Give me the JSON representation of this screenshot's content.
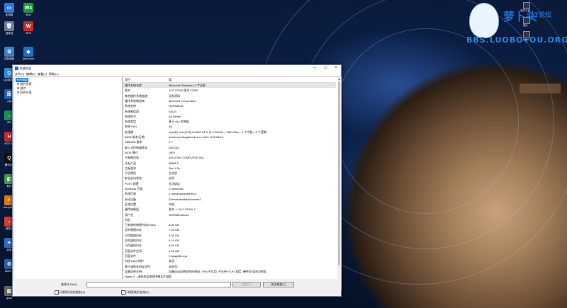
{
  "wallpaper": {
    "accent": "#0b1f45",
    "planet": "#a27d58"
  },
  "logo": {
    "title": "萝卜头",
    "subtitle": "IT论坛",
    "url": "BBS.LUOBOTOU.ORG"
  },
  "corner_items": [
    {
      "label": "我的文档"
    },
    {
      "label": "图片"
    },
    {
      "label": "good"
    }
  ],
  "thumb_label": "",
  "desktop_icons": [
    {
      "label": "此电脑",
      "color": "#2a7ad8",
      "glyph": "▭"
    },
    {
      "label": "Wox",
      "color": "#1c9a3e",
      "glyph": "Wx"
    },
    {
      "label": "回收站",
      "color": "#6c7c94",
      "glyph": "🗑"
    },
    {
      "label": "WPS",
      "color": "#d3262b",
      "glyph": "W"
    },
    {
      "label": "控制面板",
      "color": "#3b82c4",
      "glyph": "⚙"
    },
    {
      "label": "QuickLook",
      "color": "#1d6fd1",
      "glyph": "◆"
    },
    {
      "label": "QQ浏览器",
      "color": "#2f8de4",
      "glyph": "Q"
    },
    {
      "label": "火绒",
      "color": "#1e5fb8",
      "glyph": "盾"
    },
    {
      "label": "IDM",
      "color": "#1d8f4e",
      "glyph": "↓"
    },
    {
      "label": "HDTune",
      "color": "#c7282e",
      "glyph": "H"
    },
    {
      "label": "腾讯QQ",
      "color": "#111111",
      "glyph": "Q"
    },
    {
      "label": "软件",
      "color": "#3d9e3b",
      "glyph": "◧"
    },
    {
      "label": "Everything",
      "color": "#e07d12",
      "glyph": "⌕"
    },
    {
      "label": "网易云",
      "color": "#d93a2f",
      "glyph": "♪"
    },
    {
      "label": "应用",
      "color": "#2c6cc8",
      "glyph": "✦"
    },
    {
      "label": "Dism++",
      "color": "#2a5fae",
      "glyph": "⚙"
    },
    {
      "label": "good",
      "color": "#666666",
      "glyph": "▥"
    }
  ],
  "window": {
    "title": "系统信息",
    "menu": [
      "文件(F)",
      "编辑(E)",
      "查看(V)",
      "帮助(H)"
    ],
    "tree": [
      "系统摘要",
      "硬件资源",
      "组件",
      "软件环境"
    ],
    "columns": [
      "项目",
      "值"
    ],
    "rows": [
      [
        "操作系统名称",
        "Microsoft Windows 11 专业版"
      ],
      [
        "版本",
        "10.0.22000 版本 22000"
      ],
      [
        "其他操作系统描述",
        "没有资料"
      ],
      [
        "操作系统制造商",
        "Microsoft Corporation"
      ],
      [
        "系统名称",
        "NXNK8644"
      ],
      [
        "系统制造商",
        "ASUS"
      ],
      [
        "系统型号",
        "All Series"
      ],
      [
        "系统类型",
        "基于 x64 的电脑"
      ],
      [
        "系统 SKU",
        "All"
      ],
      [
        "处理器",
        "Intel(R) Core(TM) i5-4590 CPU @ 3.30GHz，3301 Mhz，4 个内核，4 个逻辑..."
      ],
      [
        "BIOS 版本/日期",
        "American Megatrends Inc. 0401, 2014/5/19"
      ],
      [
        "SMBIOS 版本",
        "2.7"
      ],
      [
        "嵌入式控制器版本",
        "255.255"
      ],
      [
        "BIOS 模式",
        "UEFI"
      ],
      [
        "主板制造商",
        "ASUSTeK COMPUTER INC."
      ],
      [
        "主板产品",
        "B85M-F"
      ],
      [
        "主板版本",
        "Rev X.0x"
      ],
      [
        "平台角色",
        "台式机"
      ],
      [
        "安全启动状态",
        "启用"
      ],
      [
        "PCR7 配置",
        "无法绑定"
      ],
      [
        "Windows 目录",
        "C:\\windows"
      ],
      [
        "系统目录",
        "C:\\windows\\system32"
      ],
      [
        "启动设备",
        "\\Device\\HarddiskVolume2"
      ],
      [
        "区域设置",
        "中国"
      ],
      [
        "硬件抽象层",
        "版本 = \"10.0.22000.1\""
      ],
      [
        "用户名",
        "NXNK8644\\user"
      ],
      [
        "时区",
        ""
      ],
      [
        "已安装的物理内存(RAM)",
        "8.00 GB"
      ],
      [
        "总的物理内存",
        "7.94 GB"
      ],
      [
        "可用物理内存",
        "4.55 GB"
      ],
      [
        "总的虚拟内存",
        "9.19 GB"
      ],
      [
        "可用虚拟内存",
        "4.83 GB"
      ],
      [
        "页面文件空间",
        "1.25 GB"
      ],
      [
        "页面文件",
        "C:\\pagefile.sys"
      ],
      [
        "内核 DMA 保护",
        "关闭"
      ],
      [
        "基于虚拟化的安全性",
        "未启用"
      ],
      [
        "设备加密支持",
        "设备自动加密失败的原因: TPM 不可用, 不支持 PCR7 绑定, 硬件安全测试界面..."
      ],
      [
        "Hyper-V - 虚拟机监视程序模式扩展",
        "是"
      ],
      [
        "Hyper-V - 第二级地址转换扩展",
        "是"
      ]
    ],
    "search_label": "查找什么(W):",
    "search_value": "",
    "find_button": "查找(D)",
    "close_find_button": "关闭查找(C)",
    "checkbox1": "只搜索所选的类别(S)",
    "checkbox2": "只搜索类别名称(R)"
  }
}
